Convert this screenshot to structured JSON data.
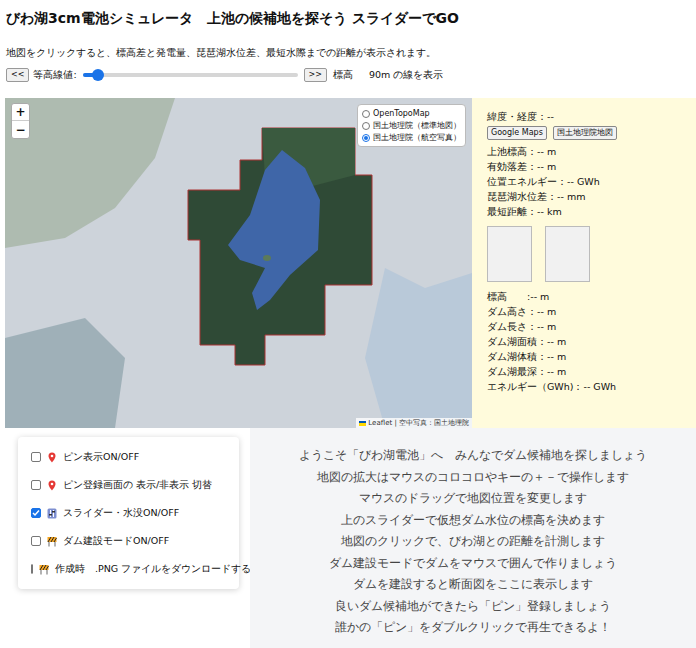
{
  "title": "びわ湖3cm電池シミュレータ　上池の候補地を探そう スライダーでGO",
  "subtitle": "地図をクリックすると、標高差と発電量、琵琶湖水位差、最短水際までの距離が表示されます。",
  "slider": {
    "prev": "<<",
    "label": "等高線値:",
    "level": 0.07,
    "next": ">>",
    "unit_label": "標高",
    "reading": "90m の線を表示"
  },
  "map": {
    "zoom_in": "+",
    "zoom_out": "−",
    "layers": [
      {
        "label": "OpenTopoMap",
        "selected": false
      },
      {
        "label": "国土地理院（標準地図）",
        "selected": false
      },
      {
        "label": "国土地理院（航空写真）",
        "selected": true
      }
    ],
    "attribution": "Leaflet | 空中写真：国土地理院"
  },
  "info": {
    "latlng": "緯度・経度：--",
    "buttons": [
      "Google Maps",
      "国土地理院地図"
    ],
    "rows1": [
      "上池標高：-- m",
      "有効落差：-- m",
      "位置エネルギー：-- GWh",
      "琵琶湖水位差：-- mm",
      "最短距離：-- km"
    ],
    "rows2": [
      "標高　　:-- m",
      "ダム高さ：-- m",
      "ダム長さ：-- m",
      "ダム湖面積：-- m",
      "ダム湖体積：-- m",
      "ダム湖最深：-- m",
      "エネルギー（GWh)：-- GWh"
    ]
  },
  "options": [
    {
      "kind": "pin",
      "label": "ピン表示ON/OFF",
      "checked": false
    },
    {
      "kind": "pin",
      "label": "ピン登録画面の 表示/非表示 切替",
      "checked": false
    },
    {
      "kind": "slider",
      "label": "スライダー・水没ON/OFF",
      "checked": true
    },
    {
      "kind": "construction",
      "label": "ダム建設モードON/OFF",
      "checked": false
    },
    {
      "kind": "construction",
      "label": "作成時　.PNG ファイルをダウンロードする",
      "checked": false
    }
  ],
  "help": [
    "ようこそ「びわ湖電池」へ　みんなでダム候補地を探しましょう",
    "地図の拡大はマウスのコロコロやキーの＋－で操作します",
    "マウスのドラッグで地図位置を変更します",
    "上のスライダーで仮想ダム水位の標高を決めます",
    "地図のクリックで、びわ湖との距離を計測します",
    "ダム建設モードでダムをマウスで囲んで作りましょう",
    "ダムを建設すると断面図をここに表示します",
    "良いダム候補地ができたら「ピン」登録しましょう",
    "誰かの「ピン」をダブルクリックで再生できるよ！"
  ]
}
